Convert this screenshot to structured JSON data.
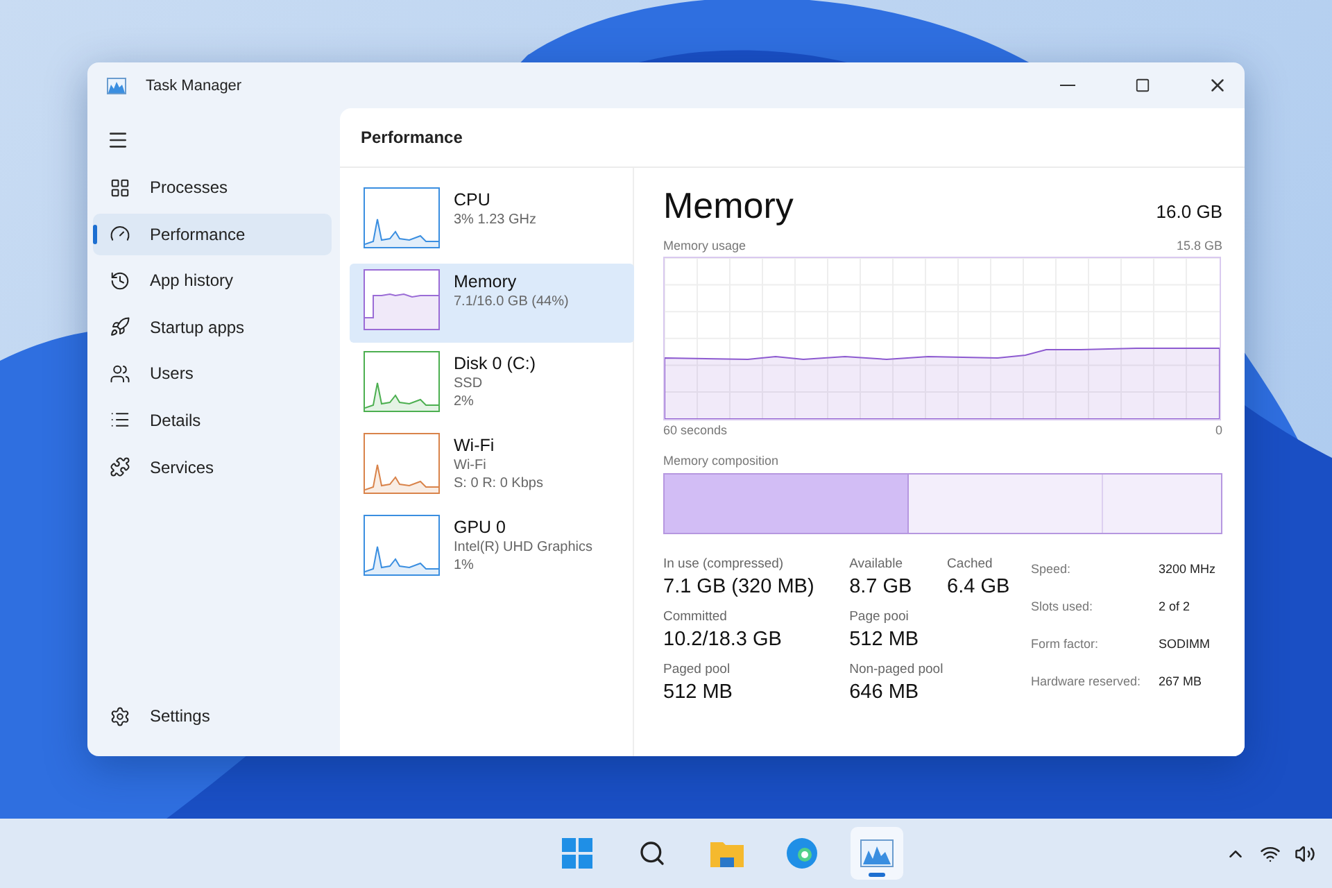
{
  "window": {
    "title": "Task Manager"
  },
  "sidebar": {
    "items": [
      {
        "label": "Processes",
        "selected": false
      },
      {
        "label": "Performance",
        "selected": true
      },
      {
        "label": "App history",
        "selected": false
      },
      {
        "label": "Startup apps",
        "selected": false
      },
      {
        "label": "Users",
        "selected": false
      },
      {
        "label": "Details",
        "selected": false
      },
      {
        "label": "Services",
        "selected": false
      }
    ],
    "settings": "Settings"
  },
  "page_title": "Performance",
  "devices": [
    {
      "name": "CPU",
      "lines": [
        "3%  1.23 GHz"
      ],
      "color": "#3a8ee0",
      "kind": "spiky",
      "selected": false
    },
    {
      "name": "Memory",
      "lines": [
        "7.1/16.0 GB (44%)"
      ],
      "color": "#9b6cd6",
      "kind": "flat",
      "selected": true
    },
    {
      "name": "Disk 0 (C:)",
      "lines": [
        "SSD",
        "2%"
      ],
      "color": "#4caf50",
      "kind": "spiky",
      "selected": false
    },
    {
      "name": "Wi-Fi",
      "lines": [
        "Wi-Fi",
        "S: 0 R: 0 Kbps"
      ],
      "color": "#d9834a",
      "kind": "spiky",
      "selected": false
    },
    {
      "name": "GPU 0",
      "lines": [
        "Intel(R) UHD Graphics",
        "1%"
      ],
      "color": "#3a8ee0",
      "kind": "spiky",
      "selected": false
    }
  ],
  "detail": {
    "title": "Memory",
    "total": "16.0 GB",
    "usage_label": "Memory usage",
    "usage_max": "15.8 GB",
    "time_start": "60 seconds",
    "time_end": "0",
    "composition_label": "Memory composition",
    "composition": {
      "level": 0.44
    },
    "stats": [
      {
        "label": "In use (compressed)",
        "value": "7.1 GB (320 MB)"
      },
      {
        "label": "Available",
        "value": "8.7 GB"
      },
      {
        "label": "Cached",
        "value": "6.4 GB"
      },
      {
        "label": "Committed",
        "value": "10.2/18.3 GB"
      },
      {
        "label": "Page pooi",
        "value": "512 MB"
      },
      {
        "label": "Paged pool",
        "value": "512 MB"
      },
      {
        "label": "Non-paged pool",
        "value": "646 MB"
      }
    ],
    "specs": [
      {
        "label": "Speed:",
        "value": "3200 MHz"
      },
      {
        "label": "Slots used:",
        "value": "2 of 2"
      },
      {
        "label": "Form factor:",
        "value": "SODIMM"
      },
      {
        "label": "Hardware reserved:",
        "value": "267 MB"
      }
    ]
  },
  "taskbar": {
    "apps": [
      {
        "selected": false
      },
      {
        "selected": false
      },
      {
        "selected": false
      },
      {
        "selected": false
      },
      {
        "selected": true
      }
    ]
  }
}
